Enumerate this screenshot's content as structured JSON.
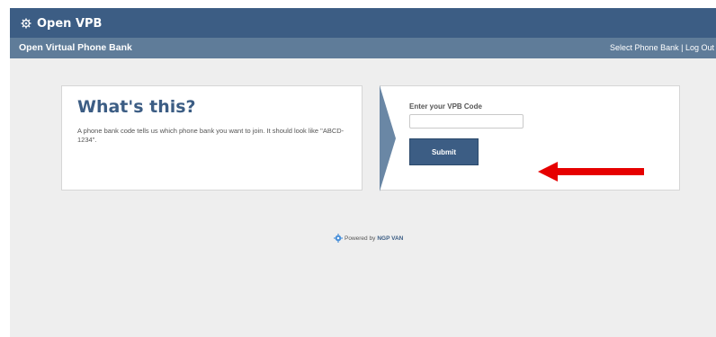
{
  "header": {
    "app_name": "Open VPB",
    "logo_icon": "gear-icon",
    "color": "#3c5d84"
  },
  "subheader": {
    "title": "Open Virtual Phone Bank",
    "nav_select": "Select Phone Bank",
    "nav_separator": "|",
    "nav_logout": "Log Out",
    "color": "#5f7c99"
  },
  "info": {
    "heading": "What's this?",
    "description": "A phone bank code tells us which phone bank you want to join.  It should look like \"ABCD-1234\"."
  },
  "form": {
    "code_label": "Enter your VPB Code",
    "code_value": "",
    "submit_label": "Submit"
  },
  "annotation": {
    "arrow_color": "#e60000"
  },
  "footer": {
    "powered_by": "Powered by",
    "brand": "NGP VAN",
    "icon": "gear-icon"
  }
}
